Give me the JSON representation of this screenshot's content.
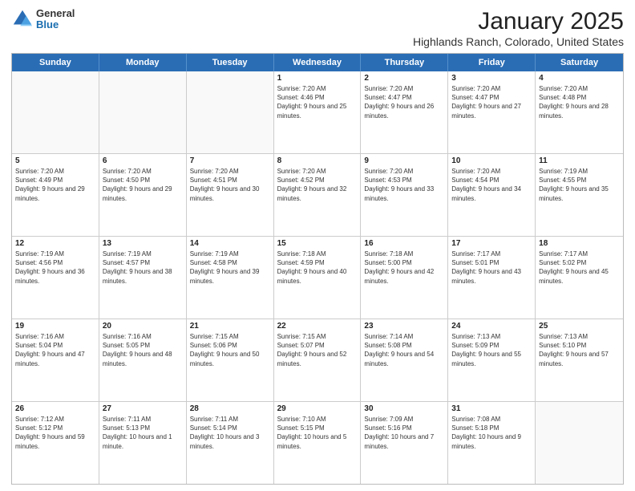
{
  "header": {
    "logo": {
      "line1": "General",
      "line2": "Blue"
    },
    "title": "January 2025",
    "location": "Highlands Ranch, Colorado, United States"
  },
  "weekdays": [
    "Sunday",
    "Monday",
    "Tuesday",
    "Wednesday",
    "Thursday",
    "Friday",
    "Saturday"
  ],
  "weeks": [
    [
      {
        "day": "",
        "sunrise": "",
        "sunset": "",
        "daylight": ""
      },
      {
        "day": "",
        "sunrise": "",
        "sunset": "",
        "daylight": ""
      },
      {
        "day": "",
        "sunrise": "",
        "sunset": "",
        "daylight": ""
      },
      {
        "day": "1",
        "sunrise": "Sunrise: 7:20 AM",
        "sunset": "Sunset: 4:46 PM",
        "daylight": "Daylight: 9 hours and 25 minutes."
      },
      {
        "day": "2",
        "sunrise": "Sunrise: 7:20 AM",
        "sunset": "Sunset: 4:47 PM",
        "daylight": "Daylight: 9 hours and 26 minutes."
      },
      {
        "day": "3",
        "sunrise": "Sunrise: 7:20 AM",
        "sunset": "Sunset: 4:47 PM",
        "daylight": "Daylight: 9 hours and 27 minutes."
      },
      {
        "day": "4",
        "sunrise": "Sunrise: 7:20 AM",
        "sunset": "Sunset: 4:48 PM",
        "daylight": "Daylight: 9 hours and 28 minutes."
      }
    ],
    [
      {
        "day": "5",
        "sunrise": "Sunrise: 7:20 AM",
        "sunset": "Sunset: 4:49 PM",
        "daylight": "Daylight: 9 hours and 29 minutes."
      },
      {
        "day": "6",
        "sunrise": "Sunrise: 7:20 AM",
        "sunset": "Sunset: 4:50 PM",
        "daylight": "Daylight: 9 hours and 29 minutes."
      },
      {
        "day": "7",
        "sunrise": "Sunrise: 7:20 AM",
        "sunset": "Sunset: 4:51 PM",
        "daylight": "Daylight: 9 hours and 30 minutes."
      },
      {
        "day": "8",
        "sunrise": "Sunrise: 7:20 AM",
        "sunset": "Sunset: 4:52 PM",
        "daylight": "Daylight: 9 hours and 32 minutes."
      },
      {
        "day": "9",
        "sunrise": "Sunrise: 7:20 AM",
        "sunset": "Sunset: 4:53 PM",
        "daylight": "Daylight: 9 hours and 33 minutes."
      },
      {
        "day": "10",
        "sunrise": "Sunrise: 7:20 AM",
        "sunset": "Sunset: 4:54 PM",
        "daylight": "Daylight: 9 hours and 34 minutes."
      },
      {
        "day": "11",
        "sunrise": "Sunrise: 7:19 AM",
        "sunset": "Sunset: 4:55 PM",
        "daylight": "Daylight: 9 hours and 35 minutes."
      }
    ],
    [
      {
        "day": "12",
        "sunrise": "Sunrise: 7:19 AM",
        "sunset": "Sunset: 4:56 PM",
        "daylight": "Daylight: 9 hours and 36 minutes."
      },
      {
        "day": "13",
        "sunrise": "Sunrise: 7:19 AM",
        "sunset": "Sunset: 4:57 PM",
        "daylight": "Daylight: 9 hours and 38 minutes."
      },
      {
        "day": "14",
        "sunrise": "Sunrise: 7:19 AM",
        "sunset": "Sunset: 4:58 PM",
        "daylight": "Daylight: 9 hours and 39 minutes."
      },
      {
        "day": "15",
        "sunrise": "Sunrise: 7:18 AM",
        "sunset": "Sunset: 4:59 PM",
        "daylight": "Daylight: 9 hours and 40 minutes."
      },
      {
        "day": "16",
        "sunrise": "Sunrise: 7:18 AM",
        "sunset": "Sunset: 5:00 PM",
        "daylight": "Daylight: 9 hours and 42 minutes."
      },
      {
        "day": "17",
        "sunrise": "Sunrise: 7:17 AM",
        "sunset": "Sunset: 5:01 PM",
        "daylight": "Daylight: 9 hours and 43 minutes."
      },
      {
        "day": "18",
        "sunrise": "Sunrise: 7:17 AM",
        "sunset": "Sunset: 5:02 PM",
        "daylight": "Daylight: 9 hours and 45 minutes."
      }
    ],
    [
      {
        "day": "19",
        "sunrise": "Sunrise: 7:16 AM",
        "sunset": "Sunset: 5:04 PM",
        "daylight": "Daylight: 9 hours and 47 minutes."
      },
      {
        "day": "20",
        "sunrise": "Sunrise: 7:16 AM",
        "sunset": "Sunset: 5:05 PM",
        "daylight": "Daylight: 9 hours and 48 minutes."
      },
      {
        "day": "21",
        "sunrise": "Sunrise: 7:15 AM",
        "sunset": "Sunset: 5:06 PM",
        "daylight": "Daylight: 9 hours and 50 minutes."
      },
      {
        "day": "22",
        "sunrise": "Sunrise: 7:15 AM",
        "sunset": "Sunset: 5:07 PM",
        "daylight": "Daylight: 9 hours and 52 minutes."
      },
      {
        "day": "23",
        "sunrise": "Sunrise: 7:14 AM",
        "sunset": "Sunset: 5:08 PM",
        "daylight": "Daylight: 9 hours and 54 minutes."
      },
      {
        "day": "24",
        "sunrise": "Sunrise: 7:13 AM",
        "sunset": "Sunset: 5:09 PM",
        "daylight": "Daylight: 9 hours and 55 minutes."
      },
      {
        "day": "25",
        "sunrise": "Sunrise: 7:13 AM",
        "sunset": "Sunset: 5:10 PM",
        "daylight": "Daylight: 9 hours and 57 minutes."
      }
    ],
    [
      {
        "day": "26",
        "sunrise": "Sunrise: 7:12 AM",
        "sunset": "Sunset: 5:12 PM",
        "daylight": "Daylight: 9 hours and 59 minutes."
      },
      {
        "day": "27",
        "sunrise": "Sunrise: 7:11 AM",
        "sunset": "Sunset: 5:13 PM",
        "daylight": "Daylight: 10 hours and 1 minute."
      },
      {
        "day": "28",
        "sunrise": "Sunrise: 7:11 AM",
        "sunset": "Sunset: 5:14 PM",
        "daylight": "Daylight: 10 hours and 3 minutes."
      },
      {
        "day": "29",
        "sunrise": "Sunrise: 7:10 AM",
        "sunset": "Sunset: 5:15 PM",
        "daylight": "Daylight: 10 hours and 5 minutes."
      },
      {
        "day": "30",
        "sunrise": "Sunrise: 7:09 AM",
        "sunset": "Sunset: 5:16 PM",
        "daylight": "Daylight: 10 hours and 7 minutes."
      },
      {
        "day": "31",
        "sunrise": "Sunrise: 7:08 AM",
        "sunset": "Sunset: 5:18 PM",
        "daylight": "Daylight: 10 hours and 9 minutes."
      },
      {
        "day": "",
        "sunrise": "",
        "sunset": "",
        "daylight": ""
      }
    ]
  ]
}
